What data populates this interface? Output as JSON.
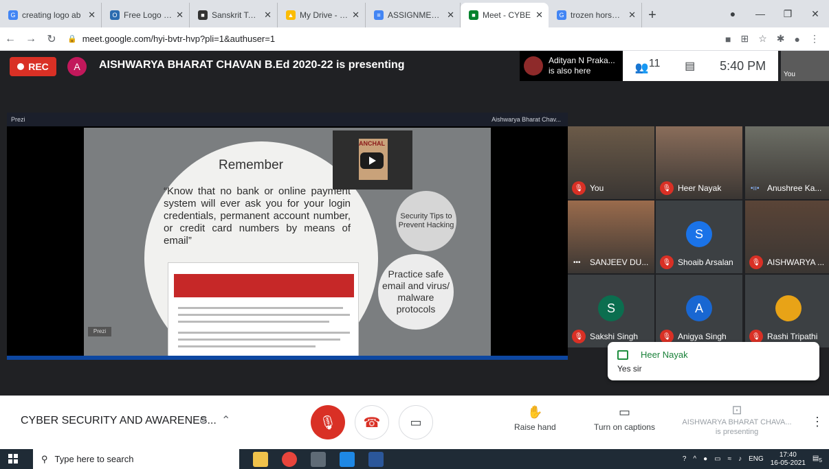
{
  "browser": {
    "tabs": [
      {
        "title": "creating logo ab",
        "fav": "#4285f4",
        "letter": "G"
      },
      {
        "title": "Free Logo Maker",
        "fav": "#2b6cb0",
        "letter": "O"
      },
      {
        "title": "Sanskrit Texts Q",
        "fav": "#333333",
        "letter": "■"
      },
      {
        "title": "My Drive - Goog",
        "fav": "#fbbc04",
        "letter": "▲"
      },
      {
        "title": "ASSIGNMENT 20",
        "fav": "#4285f4",
        "letter": "≡"
      },
      {
        "title": "Meet - CYBE",
        "fav": "#00832d",
        "letter": "■",
        "active": true
      },
      {
        "title": "trozen horse viru",
        "fav": "#4285f4",
        "letter": "G"
      }
    ],
    "new_tab": "+",
    "url": "meet.google.com/hyi-bvtr-hvp?pli=1&authuser=1"
  },
  "meet": {
    "rec_label": "REC",
    "presenter_initial": "A",
    "presenting_text": "AISHWARYA BHARAT CHAVAN B.Ed 2020-22 is presenting",
    "also_here_name": "Adityan N Praka...",
    "also_here_suffix": "is also here",
    "participant_count": "11",
    "time": "5:40 PM",
    "self_label": "You"
  },
  "presentation": {
    "app_name": "Prezi",
    "owner": "Aishwarya Bharat Chav...",
    "heading": "Remember",
    "quote": "“Know that no bank or online payment system will ever ask you for your login credentials, permanent account number, or credit card numbers by means of email”",
    "video_label": "ANCHAL",
    "tip1": "Security Tips to Prevent Hacking",
    "tip2": "Practice safe email and virus/ malware protocols",
    "logo": "Prezi"
  },
  "participants": [
    {
      "name": "You",
      "muted": true,
      "photo": "#6b5a48"
    },
    {
      "name": "Heer Nayak",
      "muted": true,
      "photo": "#8a6d5a"
    },
    {
      "name": "Anushree Ka...",
      "muted": false,
      "speaking": true,
      "photo": "#6d6f66"
    },
    {
      "name": "SANJEEV DU...",
      "muted": false,
      "more": true,
      "photo": "#9a6b4c"
    },
    {
      "name": "Shoaib Arsalan",
      "muted": true,
      "initial": "S",
      "avatar": "#1a73e8"
    },
    {
      "name": "AISHWARYA ...",
      "muted": true,
      "photo": "#5a4437"
    },
    {
      "name": "Sakshi Singh",
      "muted": true,
      "initial": "S",
      "avatar": "#0b6e4f"
    },
    {
      "name": "Anigya Singh",
      "muted": true,
      "initial": "A",
      "avatar": "#1967d2"
    },
    {
      "name": "Rashi Tripathi",
      "muted": true,
      "avatar": "#e8a317"
    }
  ],
  "chat_toast": {
    "sender": "Heer Nayak",
    "message": "Yes sir"
  },
  "controls": {
    "meeting_title": "CYBER SECURITY AND AWARENES...",
    "raise_hand": "Raise hand",
    "captions": "Turn on captions",
    "presenting_name": "AISHWARYA BHARAT CHAVA...",
    "presenting_status": "is presenting"
  },
  "taskbar": {
    "search_placeholder": "Type here to search",
    "language": "ENG",
    "clock_time": "17:40",
    "clock_date": "16-05-2021",
    "notifications": "5"
  }
}
